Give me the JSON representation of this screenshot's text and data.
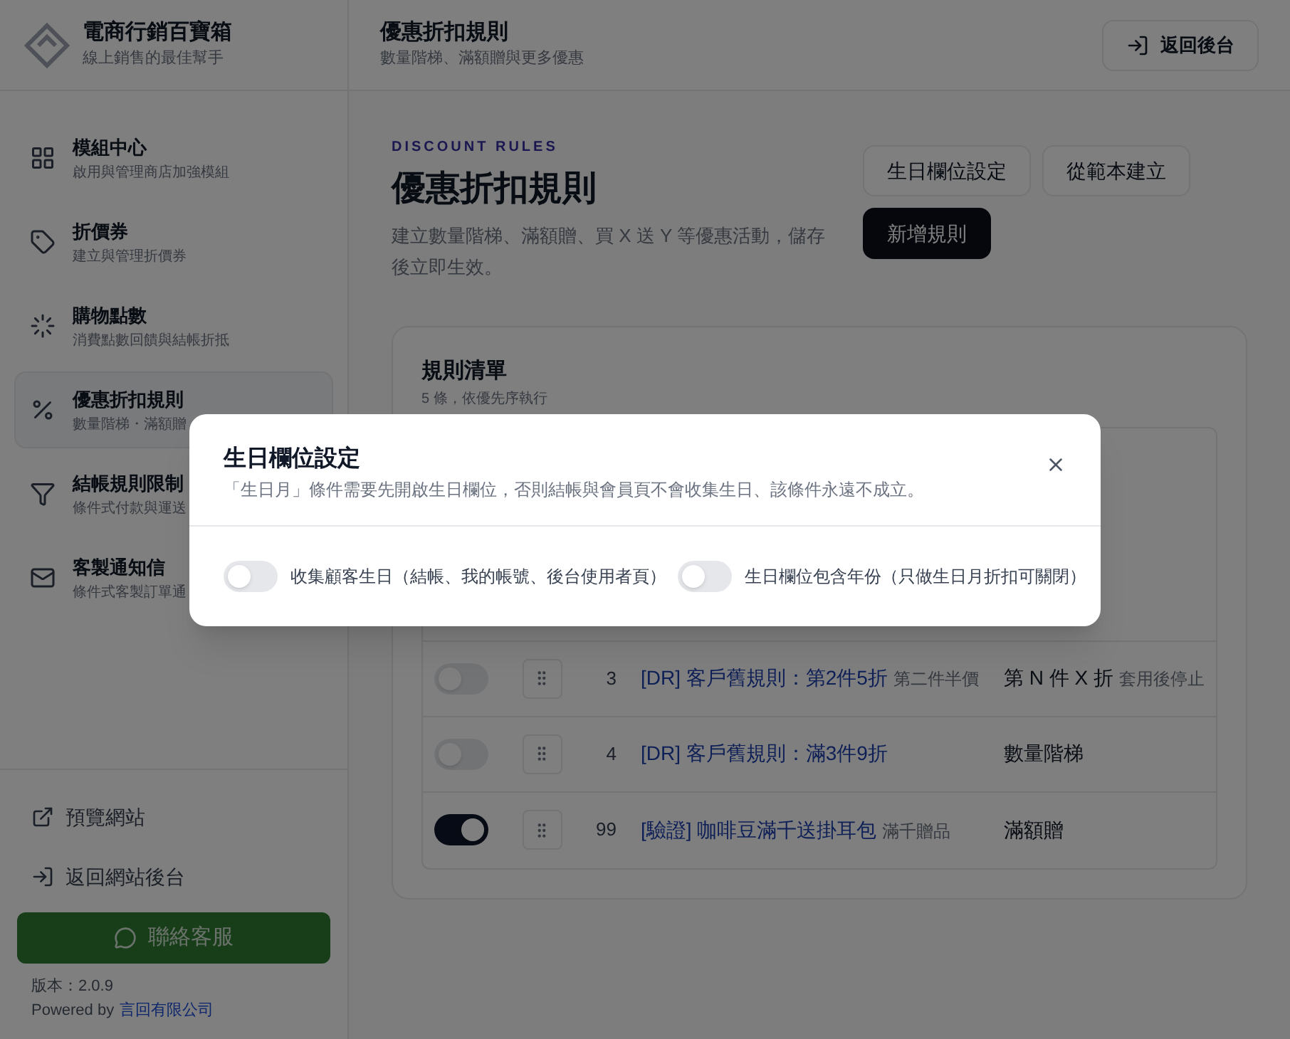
{
  "brand": {
    "name": "電商行銷百寶箱",
    "tagline": "線上銷售的最佳幫手"
  },
  "sidebar": {
    "items": [
      {
        "title": "模組中心",
        "desc": "啟用與管理商店加強模組",
        "selected": false
      },
      {
        "title": "折價券",
        "desc": "建立與管理折價券",
        "selected": false
      },
      {
        "title": "購物點數",
        "desc": "消費點數回饋與結帳折抵",
        "selected": false
      },
      {
        "title": "優惠折扣規則",
        "desc": "數量階梯・滿額贈",
        "selected": true
      },
      {
        "title": "結帳規則限制",
        "desc": "條件式付款與運送",
        "selected": false
      },
      {
        "title": "客製通知信",
        "desc": "條件式客製訂單通",
        "selected": false
      }
    ],
    "links": [
      {
        "label": "預覽網站"
      },
      {
        "label": "返回網站後台"
      }
    ],
    "support_button": "聯絡客服",
    "version": "版本：2.0.9",
    "powered_by": "Powered by",
    "company": "言回有限公司"
  },
  "header": {
    "title": "優惠折扣規則",
    "subtitle": "數量階梯、滿額贈與更多優惠",
    "back_button": "返回後台"
  },
  "page": {
    "eyebrow": "DISCOUNT RULES",
    "title": "優惠折扣規則",
    "description": "建立數量階梯、滿額贈、買 X 送 Y 等優惠活動，儲存後立即生效。",
    "buttons": [
      "生日欄位設定",
      "從範本建立"
    ],
    "primary_button": "新增規則"
  },
  "rules_card": {
    "title": "規則清單",
    "subtitle": "5 條，依優先序執行",
    "rows": [
      {
        "on": false,
        "priority": "3",
        "name": "[DR] 客戶舊規則：第2件5折",
        "note": "第二件半價",
        "type": "第 N 件 X 折",
        "type_note": "套用後停止"
      },
      {
        "on": false,
        "priority": "4",
        "name": "[DR] 客戶舊規則：滿3件9折",
        "type": "數量階梯"
      },
      {
        "on": true,
        "priority": "99",
        "name": "[驗證] 咖啡豆滿千送掛耳包",
        "note": "滿千贈品",
        "type": "滿額贈"
      }
    ]
  },
  "dialog": {
    "title": "生日欄位設定",
    "description": "「生日月」條件需要先開啟生日欄位，否則結帳與會員頁不會收集生日、該條件永遠不成立。",
    "toggles": [
      {
        "label": "收集顧客生日（結帳、我的帳號、後台使用者頁）",
        "on": false
      },
      {
        "label": "生日欄位包含年份（只做生日月折扣可關閉）",
        "on": false
      }
    ]
  }
}
